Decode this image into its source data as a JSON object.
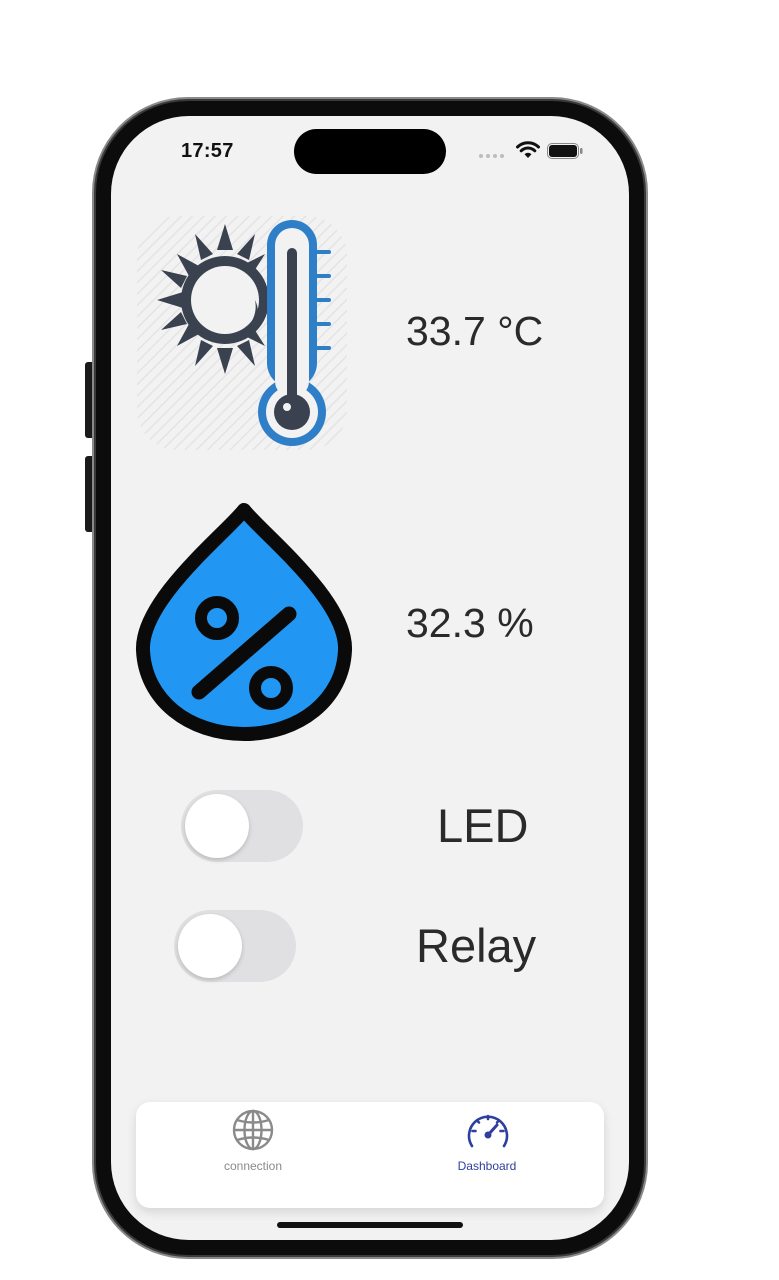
{
  "status_bar": {
    "time": "17:57"
  },
  "temperature": {
    "value": "33.7 °C",
    "icon": "thermometer-sun-icon"
  },
  "humidity": {
    "value": "32.3 %",
    "icon": "humidity-drop-icon"
  },
  "controls": {
    "led": {
      "label": "LED",
      "on": false
    },
    "relay": {
      "label": "Relay",
      "on": false
    }
  },
  "tab_bar": {
    "tabs": [
      {
        "label": "connection",
        "icon": "globe-icon",
        "active": false
      },
      {
        "label": "Dashboard",
        "icon": "speedometer-icon",
        "active": true
      }
    ]
  },
  "colors": {
    "accent": "#2e3f9e",
    "drop": "#2196f3",
    "thermo": "#2f7fc8",
    "background": "#f2f2f2"
  }
}
